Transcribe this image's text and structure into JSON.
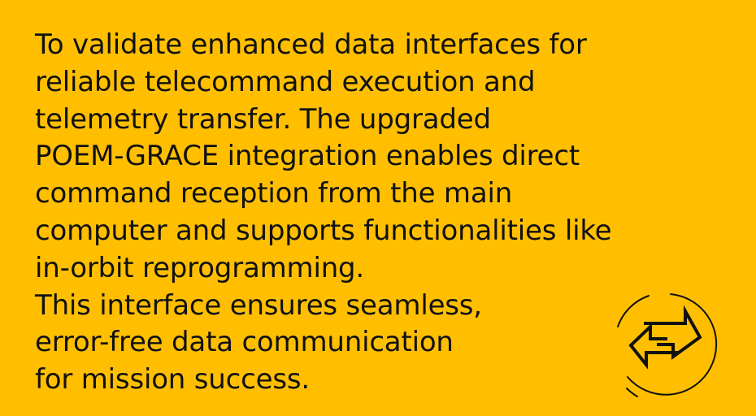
{
  "colors": {
    "background": "#FFBF00",
    "text": "#111111",
    "icon": "#111111"
  },
  "icons": {
    "main": "bidirectional-arrows-icon"
  },
  "content": {
    "lines": [
      "To validate enhanced data interfaces for",
      "reliable telecommand execution and",
      "telemetry transfer. The upgraded",
      "POEM-GRACE integration enables direct",
      "command reception from the main",
      "computer and supports functionalities like",
      "in-orbit reprogramming.",
      "This interface ensures seamless,",
      "error-free data communication",
      "for mission success."
    ]
  }
}
